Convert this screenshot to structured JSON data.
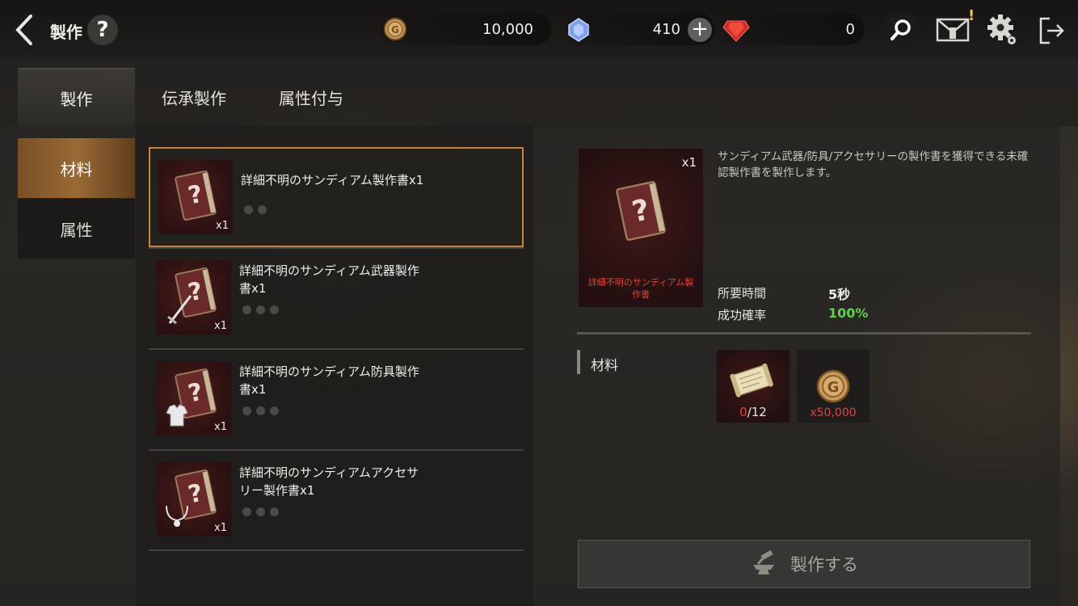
{
  "header": {
    "title": "製作",
    "help_label": "?",
    "gold": "10,000",
    "crystal": "410",
    "ruby": "0",
    "notif_mark": "!"
  },
  "tabs": [
    {
      "label": "製作",
      "active": true
    },
    {
      "label": "伝承製作",
      "active": false
    },
    {
      "label": "属性付与",
      "active": false
    }
  ],
  "side_categories": [
    {
      "label": "材料",
      "active": true
    },
    {
      "label": "属性",
      "active": false
    }
  ],
  "recipes": [
    {
      "name": "詳細不明のサンディアム製作書x1",
      "qty": "x1",
      "dots": 2,
      "selected": true,
      "overlay": "none"
    },
    {
      "name": "詳細不明のサンディアム武器製作書x1",
      "qty": "x1",
      "dots": 3,
      "selected": false,
      "overlay": "sword-icon"
    },
    {
      "name": "詳細不明のサンディアム防具製作書x1",
      "qty": "x1",
      "dots": 3,
      "selected": false,
      "overlay": "armor-icon"
    },
    {
      "name": "詳細不明のサンディアムアクセサリー製作書x1",
      "qty": "x1",
      "dots": 3,
      "selected": false,
      "overlay": "necklace-icon"
    }
  ],
  "recipe_lines": [
    [
      "詳細不明のサンディアム製作書x1"
    ],
    [
      "詳細不明のサンディアム武器製作",
      "書x1"
    ],
    [
      "詳細不明のサンディアム防具製作",
      "書x1"
    ],
    [
      "詳細不明のサンディアムアクセサ",
      "リー製作書x1"
    ]
  ],
  "detail": {
    "qty": "x1",
    "item_name_line1": "詳細不明のサンディアム製",
    "item_name_line2": "作書",
    "description_line1": "サンディアム武器/防具/アクセサリーの製作書を獲得できる未確",
    "description_line2": "認製作書を製作します。",
    "time_label": "所要時間",
    "time_value": "5秒",
    "rate_label": "成功確率",
    "rate_value": "100%",
    "rate_color": "#5fd14a"
  },
  "materials": {
    "label": "材料",
    "items": [
      {
        "icon": "scroll-icon",
        "have": "0",
        "need": "/12",
        "have_color": "#e0453a"
      },
      {
        "icon": "gold-coin-icon",
        "amount": "x50,000",
        "color": "#e0453a"
      }
    ]
  },
  "craft_button": {
    "label": "製作する"
  }
}
